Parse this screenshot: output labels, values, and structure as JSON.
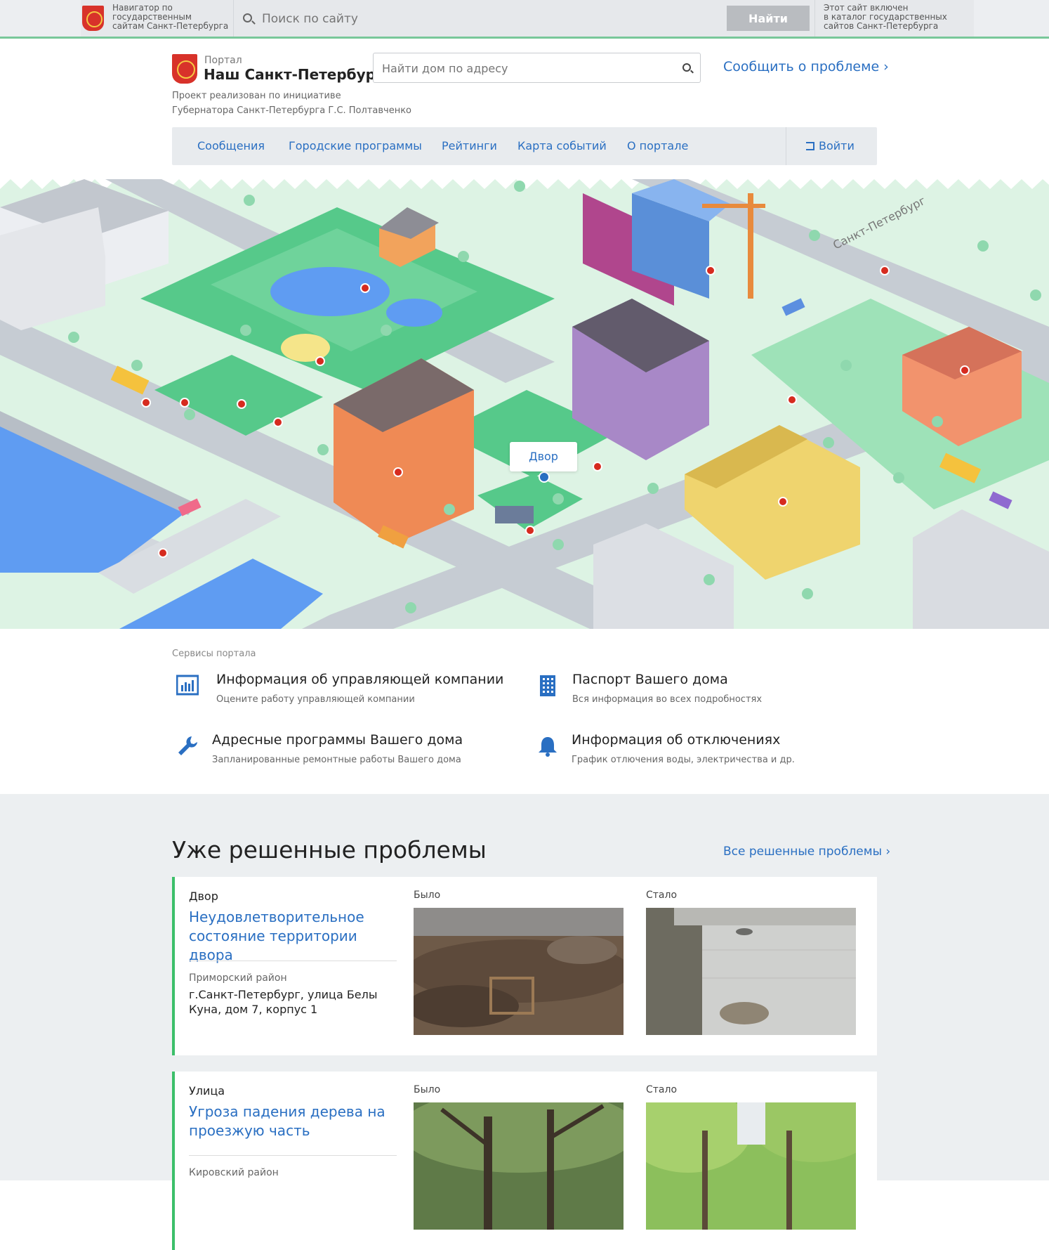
{
  "gov_bar": {
    "navigator_text": "Навигатор по\nгосударственным\nсайтам Санкт-Петербурга",
    "search_placeholder": "Поиск по сайту",
    "search_button": "Найти",
    "catalog_text": "Этот сайт включен\nв каталог государственных\nсайтов Санкт-Петербурга"
  },
  "header": {
    "portal_small": "Портал",
    "portal_name": "Наш Санкт-Петербург",
    "initiative": "Проект реализован по инициативе\nГубернатора Санкт-Петербурга Г.С. Полтавченко",
    "address_placeholder": "Найти дом по адресу",
    "report_link": "Сообщить о проблеме ›"
  },
  "nav": {
    "items": [
      {
        "label": "Сообщения"
      },
      {
        "label": "Городские программы"
      },
      {
        "label": "Рейтинги"
      },
      {
        "label": "Карта событий"
      },
      {
        "label": "О портале"
      }
    ],
    "login": "Войти"
  },
  "hero": {
    "tooltip": "Двор",
    "bridge_sign": "Санкт-Петербург",
    "colors": {
      "ground": "#ddf3e4",
      "park": "#56c98a",
      "road": "#c6ccd3",
      "water": "#5f9cf2",
      "marker": "#d62b1f"
    }
  },
  "services": {
    "title": "Сервисы портала",
    "items": [
      {
        "icon": "bar-chart-icon",
        "title": "Информация об управляющей компании",
        "subtitle": "Оцените работу управляющей компании"
      },
      {
        "icon": "building-icon",
        "title": "Паспорт Вашего дома",
        "subtitle": "Вся информация во всех подробностях"
      },
      {
        "icon": "wrench-icon",
        "title": "Адресные программы Вашего дома",
        "subtitle": "Запланированные ремонтные работы Вашего дома"
      },
      {
        "icon": "bell-icon",
        "title": "Информация об отключениях",
        "subtitle": "График отлючения воды, электричества и др."
      }
    ]
  },
  "solved": {
    "title": "Уже решенные проблемы",
    "all_link": "Все решенные проблемы ›",
    "before_label": "Было",
    "after_label": "Стало",
    "cards": [
      {
        "category": "Двор",
        "title": "Неудовлетворительное состояние территории двора",
        "district": "Приморский район",
        "address": "г.Санкт-Петербург, улица Белы Куна, дом 7, корпус 1"
      },
      {
        "category": "Улица",
        "title": "Угроза падения дерева на проезжую часть",
        "district": "Кировский район",
        "address": ""
      }
    ]
  }
}
